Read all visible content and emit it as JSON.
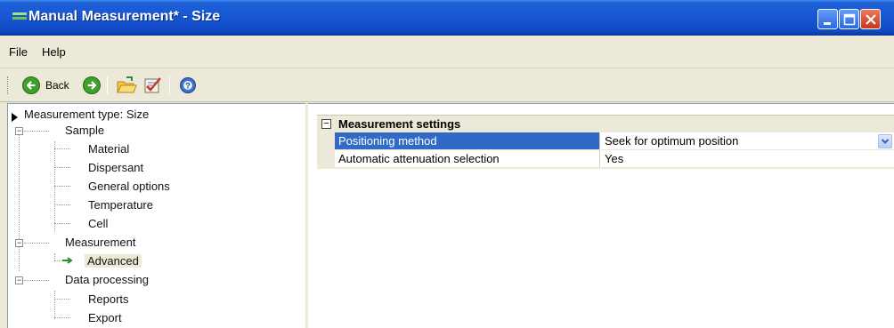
{
  "window": {
    "title": "Manual Measurement* - Size",
    "colors": {
      "titlebar": "#1656d2",
      "selection": "#316ac5",
      "chrome": "#ece9d8"
    }
  },
  "menu": {
    "items": [
      "File",
      "Help"
    ]
  },
  "toolbar": {
    "back_label": "Back",
    "icons": [
      "back-arrow-icon",
      "forward-arrow-icon",
      "open-folder-icon",
      "checklist-icon",
      "help-icon"
    ]
  },
  "tree": {
    "root_label": "Measurement type: Size",
    "nodes": [
      {
        "label": "Sample",
        "children": [
          "Material",
          "Dispersant",
          "General options",
          "Temperature",
          "Cell"
        ]
      },
      {
        "label": "Measurement",
        "children": [
          "Advanced"
        ]
      },
      {
        "label": "Data processing",
        "children": [
          "Reports",
          "Export"
        ]
      }
    ],
    "selected": "Advanced"
  },
  "properties": {
    "category": "Measurement settings",
    "rows": [
      {
        "name": "Positioning method",
        "value": "Seek for optimum position"
      },
      {
        "name": "Automatic attenuation selection",
        "value": "Yes"
      }
    ]
  }
}
